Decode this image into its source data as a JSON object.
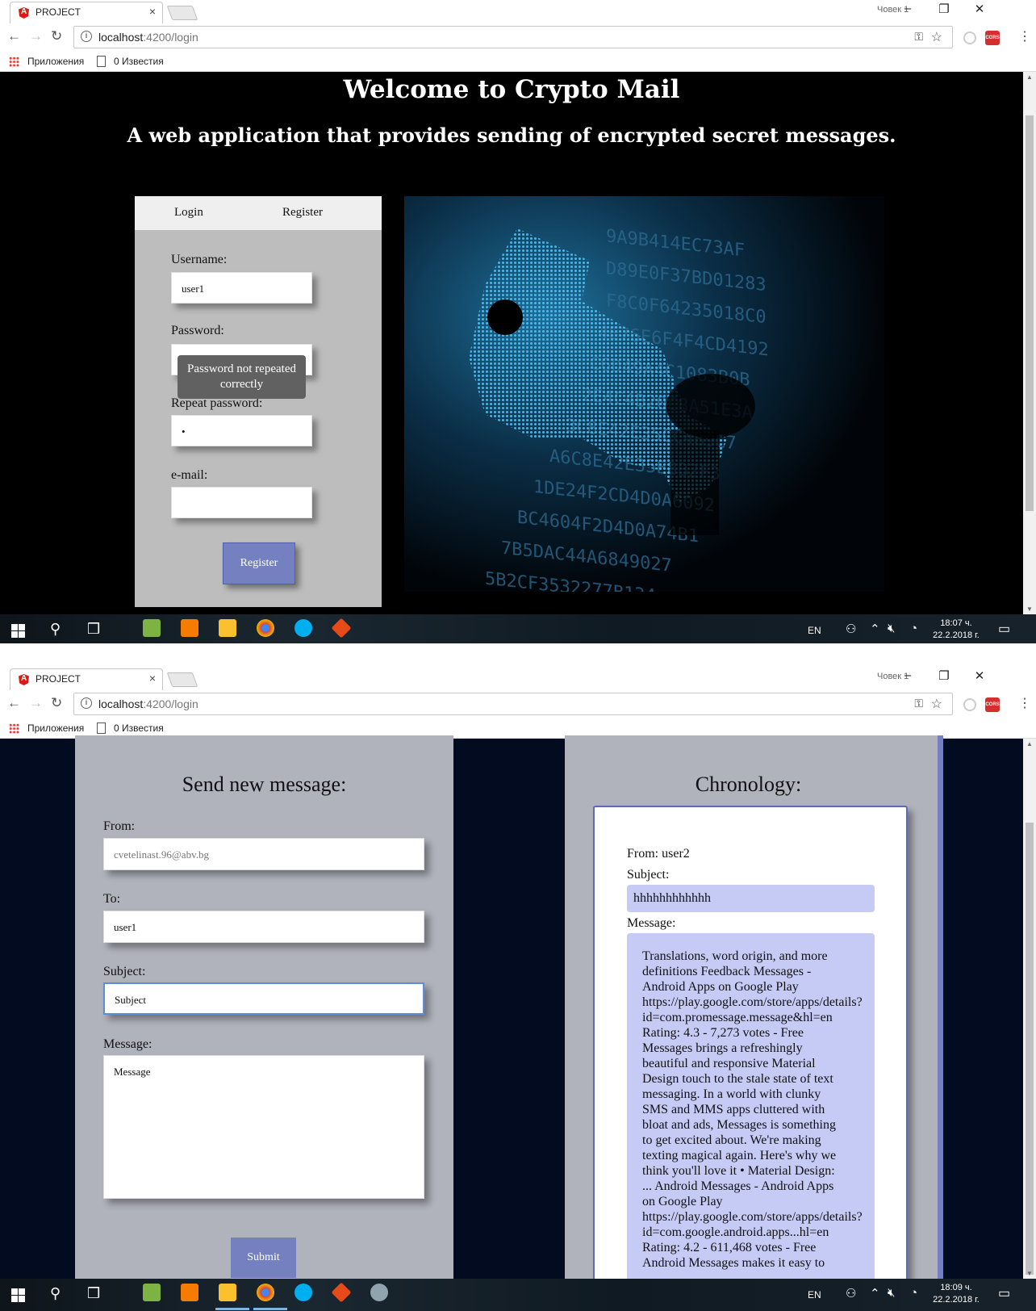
{
  "browser": {
    "tab_title": "PROJECT",
    "tab_close": "×",
    "profile": "Човек 1",
    "url_host": "localhost",
    "url_path": ":4200/login",
    "bookmark_apps": "Приложения",
    "bookmark_news": "0 Известия",
    "ext_cors": "CORS",
    "window_minimize": "–",
    "window_restore": "❐",
    "window_close": "✕"
  },
  "login_page": {
    "title": "Welcome to Crypto Mail",
    "subtitle": "A web application that provides sending of encrypted secret messages.",
    "tabs": [
      "Login",
      "Register"
    ],
    "username_label": "Username:",
    "username_value": "user1",
    "password_label": "Password:",
    "password_value": "•••••",
    "tooltip": "Password not repeated correctly",
    "repeat_label": "Repeat password:",
    "repeat_value": "•",
    "email_label": "e-mail:",
    "email_value": "",
    "register_button": "Register"
  },
  "mail_page": {
    "send_title": "Send new message:",
    "from_label": "From:",
    "from_value": "cvetelinast.96@abv.bg",
    "to_label": "To:",
    "to_value": "user1",
    "subject_label": "Subject:",
    "subject_value": "Subject",
    "message_label": "Message:",
    "message_value": "Message",
    "submit_button": "Submit",
    "chronology_title": "Chronology:",
    "item": {
      "from": "From: user2",
      "subject_label": "Subject:",
      "subject": "hhhhhhhhhhhh",
      "message_label": "Message:",
      "body_lines": [
        "Translations, word origin, and more",
        "definitions Feedback Messages -",
        "Android Apps on Google Play",
        "https://play.google.com/store/apps/details?",
        "id=com.promessage.message&hl=en",
        "Rating: 4.3 - 7,273 votes - Free",
        "Messages brings a refreshingly",
        "beautiful and responsive Material",
        "Design touch to the stale state of text",
        "messaging. In a world with clunky",
        "SMS and MMS apps cluttered with",
        "bloat and ads, Messages is something",
        "to get excited about. We're making",
        "texting magical again. Here's why we",
        "think you'll love it • Material Design:",
        "... Android Messages - Android Apps",
        "on Google Play",
        "https://play.google.com/store/apps/details?",
        "id=com.google.android.apps...hl=en",
        "Rating: 4.2 - 611,468 votes - Free",
        "Android Messages makes it easy to"
      ]
    }
  },
  "taskbar": {
    "lang": "EN",
    "time1": "18:07 ч.",
    "time2": "18:09 ч.",
    "date": "22.2.2018 г."
  },
  "colors": {
    "accent_button": "#7480bf",
    "panel_gray": "#bdbdbd",
    "page2_background": "#020b20",
    "message_highlight": "#c5cbf5"
  }
}
